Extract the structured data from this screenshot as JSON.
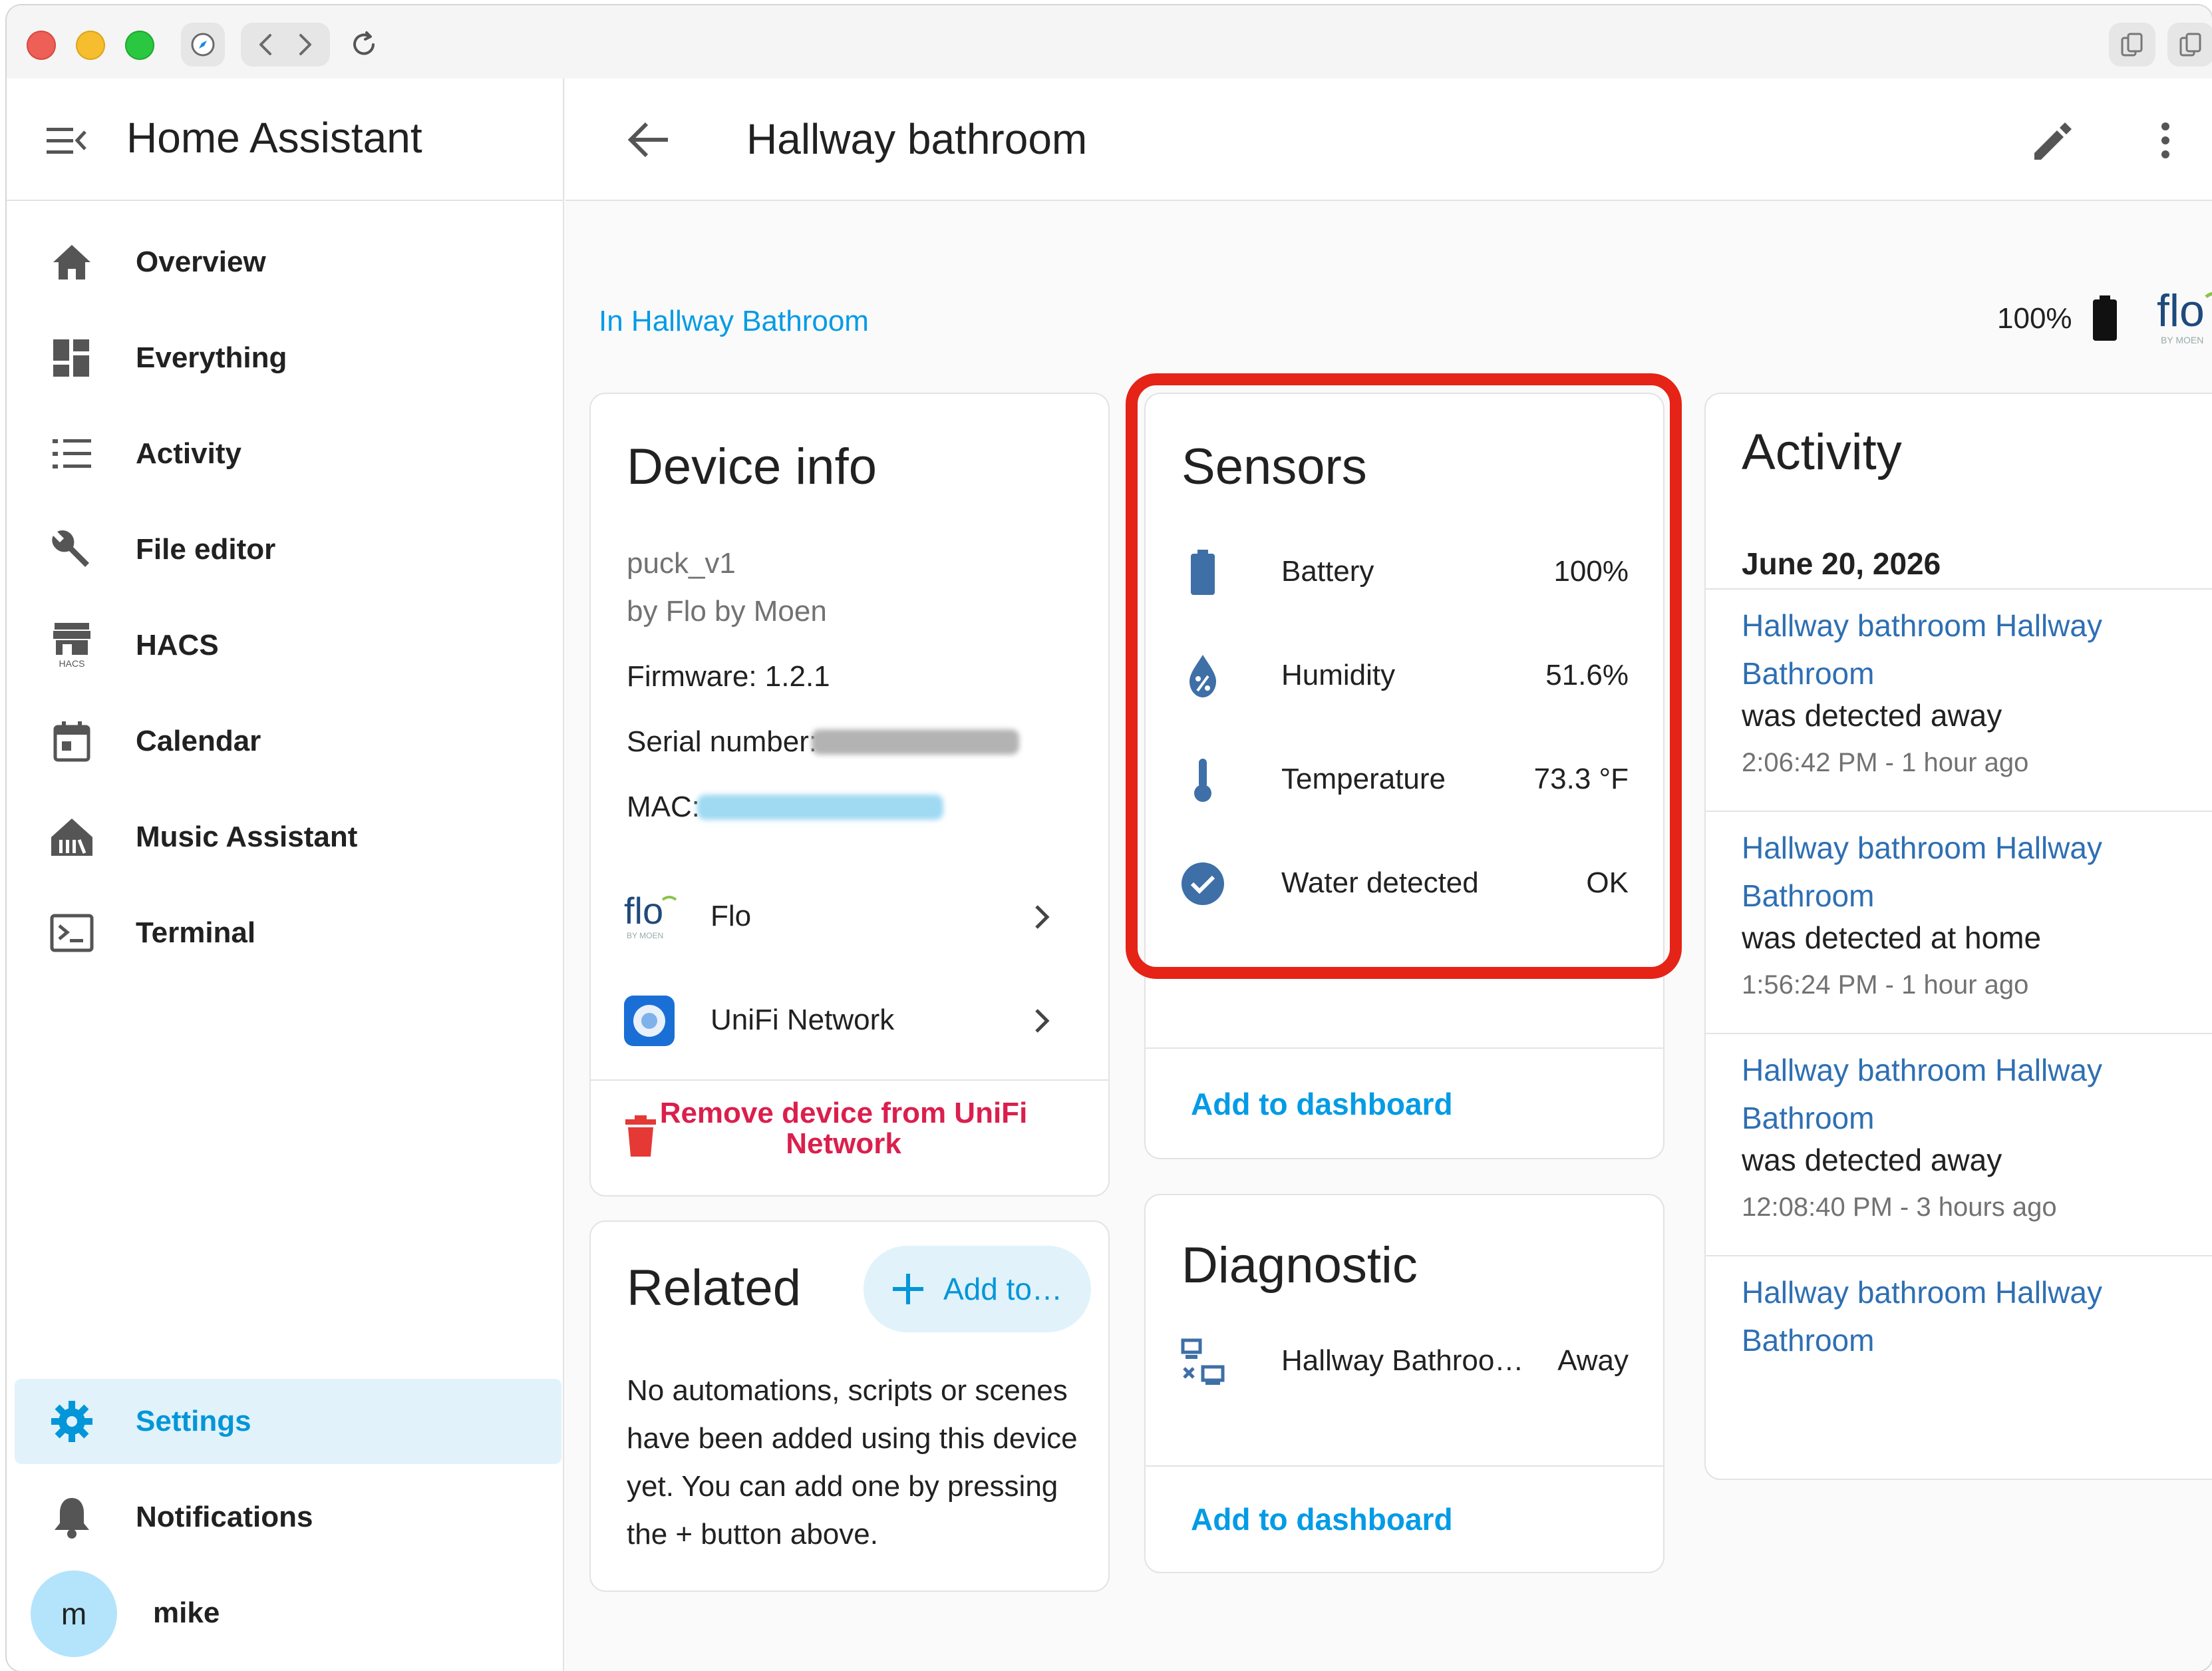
{
  "colors": {
    "accent": "#039be5",
    "icon": "#3e6fa7",
    "danger": "#db1f4d",
    "highlight": "#e52317",
    "active_bg": "#e1f2fb"
  },
  "sidebar": {
    "app_title": "Home Assistant",
    "items": [
      {
        "label": "Overview",
        "icon": "home-icon"
      },
      {
        "label": "Everything",
        "icon": "dashboard-grid-icon"
      },
      {
        "label": "Activity",
        "icon": "list-icon"
      },
      {
        "label": "File editor",
        "icon": "wrench-icon"
      },
      {
        "label": "HACS",
        "icon": "hacs-store-icon",
        "sublabel": "HACS"
      },
      {
        "label": "Calendar",
        "icon": "calendar-icon"
      },
      {
        "label": "Music Assistant",
        "icon": "music-assistant-icon"
      },
      {
        "label": "Terminal",
        "icon": "terminal-icon"
      }
    ],
    "settings_label": "Settings",
    "notifications_label": "Notifications",
    "user": {
      "initial": "m",
      "name": "mike"
    }
  },
  "header": {
    "title": "Hallway bathroom"
  },
  "area_link": "In Hallway Bathroom",
  "battery_level": "100%",
  "device_info": {
    "title": "Device info",
    "model": "puck_v1",
    "manufacturer": "by Flo by Moen",
    "firmware": "Firmware: 1.2.1",
    "serial_label": "Serial number:",
    "mac_label": "MAC:",
    "integrations": [
      {
        "label": "Flo",
        "icon": "flo-logo-icon"
      },
      {
        "label": "UniFi Network",
        "icon": "unifi-icon"
      }
    ],
    "remove_label": "Remove device from UniFi Network"
  },
  "related": {
    "title": "Related",
    "add_label": "Add to…",
    "text": "No automations, scripts or scenes have been added using this device yet. You can add one by pressing the + button above."
  },
  "sensors": {
    "title": "Sensors",
    "rows": [
      {
        "label": "Battery",
        "value": "100%",
        "icon": "battery-icon"
      },
      {
        "label": "Humidity",
        "value": "51.6%",
        "icon": "water-percent-icon"
      },
      {
        "label": "Temperature",
        "value": "73.3 °F",
        "icon": "thermometer-icon"
      },
      {
        "label": "Water detected",
        "value": "OK",
        "icon": "check-circle-icon"
      }
    ],
    "add_to_dashboard": "Add to dashboard"
  },
  "diagnostic": {
    "title": "Diagnostic",
    "rows": [
      {
        "label": "Hallway Bathroo…",
        "value": "Away",
        "icon": "lan-disconnect-icon"
      }
    ],
    "add_to_dashboard": "Add to dashboard"
  },
  "activity": {
    "title": "Activity",
    "date": "June 20, 2026",
    "entries": [
      {
        "title": "Hallway bathroom Hallway Bathroom",
        "desc": "was detected away",
        "time": "2:06:42 PM - 1 hour ago"
      },
      {
        "title": "Hallway bathroom Hallway Bathroom",
        "desc": "was detected at home",
        "time": "1:56:24 PM - 1 hour ago"
      },
      {
        "title": "Hallway bathroom Hallway Bathroom",
        "desc": "was detected away",
        "time": "12:08:40 PM - 3 hours ago"
      },
      {
        "title": "Hallway bathroom Hallway Bathroom",
        "desc": "",
        "time": ""
      }
    ]
  }
}
